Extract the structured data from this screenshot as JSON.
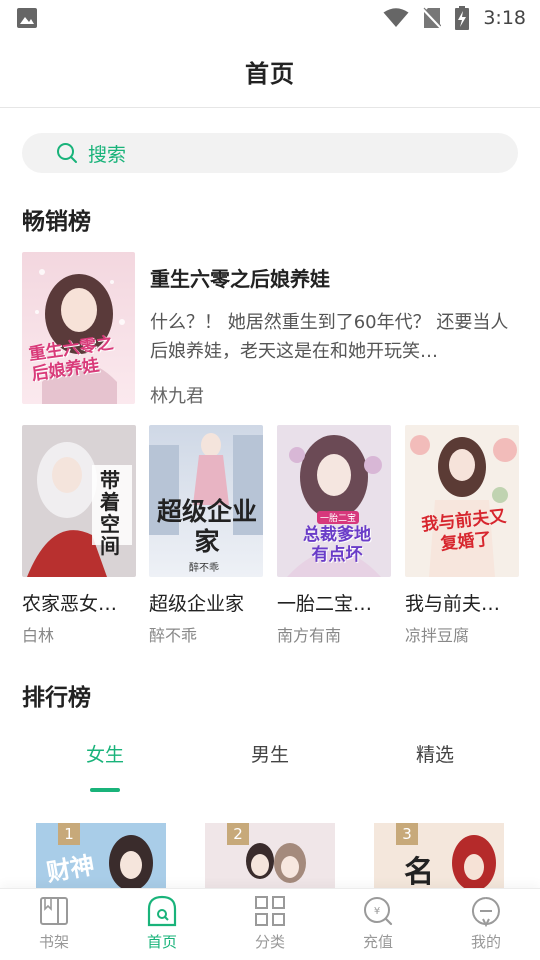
{
  "status_bar": {
    "time": "3:18"
  },
  "header": {
    "title": "首页"
  },
  "search": {
    "placeholder": "搜索"
  },
  "bestseller": {
    "title": "畅销榜",
    "featured": {
      "title": "重生六零之后娘养娃",
      "description": "什么？！ 她居然重生到了60年代？ 还要当人后娘养娃，老天这是在和她开玩笑…",
      "author": "林九君",
      "cover_text": "重生六零之后娘养娃"
    },
    "books": [
      {
        "name": "农家恶女…",
        "author": "白林",
        "cover_text": "带着空间"
      },
      {
        "name": "超级企业家",
        "author": "醉不乖",
        "cover_text": "超级企业家",
        "cover_sub": "醉不乖"
      },
      {
        "name": "一胎二宝…",
        "author": "南方有南",
        "cover_text": "总裁爹地有点坏",
        "cover_sub": "一胎二宝"
      },
      {
        "name": "我与前夫…",
        "author": "凉拌豆腐",
        "cover_text": "我与前夫又复婚了"
      }
    ]
  },
  "ranking": {
    "title": "排行榜",
    "tabs": [
      "女生",
      "男生",
      "精选"
    ],
    "active_tab": "女生",
    "items": [
      {
        "rank": "1",
        "cover_text": "财神"
      },
      {
        "rank": "2"
      },
      {
        "rank": "3",
        "cover_text": "名"
      }
    ]
  },
  "bottom_nav": {
    "items": [
      {
        "label": "书架",
        "icon": "book-icon"
      },
      {
        "label": "首页",
        "icon": "home-icon"
      },
      {
        "label": "分类",
        "icon": "grid-icon"
      },
      {
        "label": "充值",
        "icon": "recharge-icon"
      },
      {
        "label": "我的",
        "icon": "profile-icon"
      }
    ],
    "active": "首页"
  },
  "colors": {
    "accent": "#19b37a",
    "rank_badge": "#c7a97a"
  }
}
